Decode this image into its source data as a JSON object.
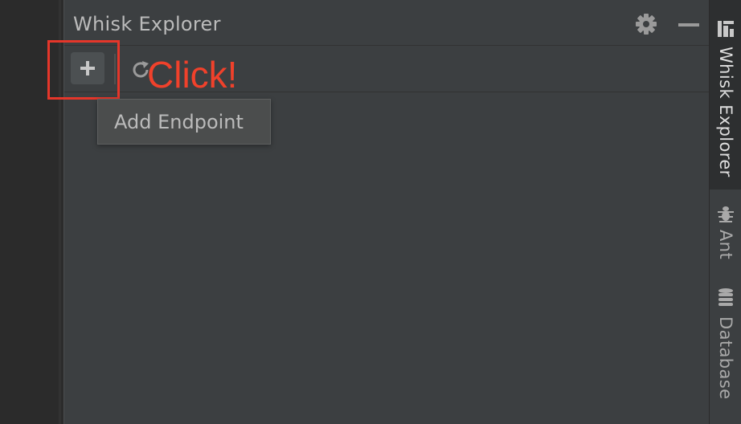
{
  "panel": {
    "title": "Whisk Explorer",
    "icons": {
      "settings": "gear-icon",
      "minimize": "minimize-icon"
    }
  },
  "toolbar": {
    "add_icon": "plus-icon",
    "refresh_icon": "refresh-icon"
  },
  "tooltip": {
    "text": "Add Endpoint"
  },
  "annotation": {
    "text": "Click!",
    "color": "#f0412b",
    "box_color": "#e5362a"
  },
  "sidebar": {
    "tabs": [
      {
        "label": "Whisk Explorer",
        "icon": "tool-window-icon",
        "active": true
      },
      {
        "label": "Ant",
        "icon": "ant-icon",
        "active": false
      },
      {
        "label": "Database",
        "icon": "database-icon",
        "active": false
      }
    ]
  },
  "colors": {
    "panel_bg": "#3c3f41",
    "editor_bg": "#2b2b2b",
    "text": "#bbbbbb"
  }
}
